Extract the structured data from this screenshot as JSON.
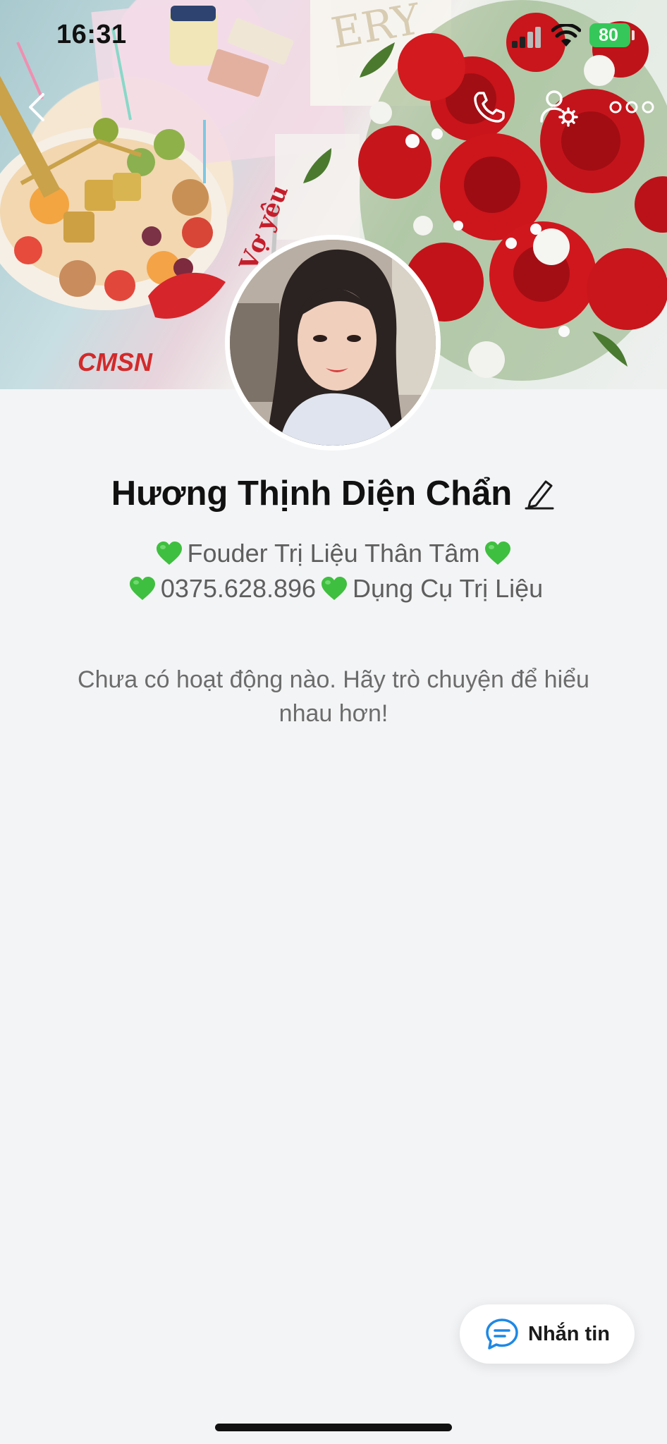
{
  "status_bar": {
    "time": "16:31",
    "battery": "80"
  },
  "profile": {
    "name": "Hương Thịnh Diện Chẩn",
    "bio_line1": "Fouder Trị Liệu Thân Tâm",
    "bio_line2_phone": "0375.628.896",
    "bio_line2_text": "Dụng Cụ Trị Liệu"
  },
  "feed": {
    "empty_message": "Chưa có hoạt động nào. Hãy trò chuyện để hiểu nhau hơn!"
  },
  "actions": {
    "chat_label": "Nhắn tin"
  },
  "cover": {
    "sticker_logo": "CMSN",
    "sticker_text": "Vợ yêu",
    "box_text": "ERY"
  },
  "colors": {
    "accent_green": "#35c759",
    "heart_green": "#3fbf3f",
    "chat_icon_blue": "#1e88e5"
  },
  "icons": {
    "back": "chevron-left-icon",
    "call": "phone-icon",
    "settings": "user-settings-icon",
    "more": "more-icon",
    "edit": "pencil-icon",
    "heart": "green-heart-icon",
    "chat": "chat-bubble-icon"
  }
}
